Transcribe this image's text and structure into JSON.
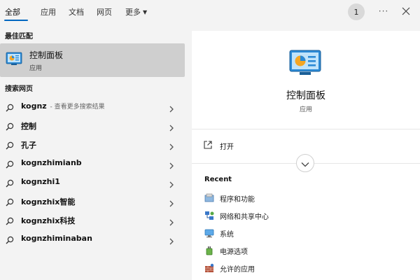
{
  "tabs": [
    {
      "label": "全部",
      "active": true
    },
    {
      "label": "应用"
    },
    {
      "label": "文档"
    },
    {
      "label": "网页"
    },
    {
      "label": "更多"
    }
  ],
  "account_badge": "1",
  "sections": {
    "best_match": "最佳匹配",
    "search_web": "搜索网页",
    "recent": "Recent"
  },
  "best_match": {
    "name": "控制面板",
    "type": "应用",
    "icon": "control-panel-icon"
  },
  "web_results": [
    {
      "query": "kognz",
      "hint": " - 查看更多搜索结果"
    },
    {
      "query": "控制"
    },
    {
      "query": "孔子"
    },
    {
      "query": "kognzhimianb"
    },
    {
      "query": "kognzhi1"
    },
    {
      "query": "kognzhix智能"
    },
    {
      "query": "kognzhix科技"
    },
    {
      "query": "kognzhiminaban"
    }
  ],
  "preview": {
    "title": "控制面板",
    "subtitle": "应用",
    "open_label": "打开"
  },
  "recent": [
    {
      "label": "程序和功能",
      "icon": "programs-icon"
    },
    {
      "label": "网络和共享中心",
      "icon": "network-icon"
    },
    {
      "label": "系统",
      "icon": "system-icon"
    },
    {
      "label": "电源选项",
      "icon": "power-icon"
    },
    {
      "label": "允许的应用",
      "icon": "firewall-icon"
    }
  ],
  "colors": {
    "accent": "#0067c0",
    "selected_bg": "#cfcfcf",
    "panel_bg": "#ffffff",
    "window_bg": "#f3f3f3"
  }
}
